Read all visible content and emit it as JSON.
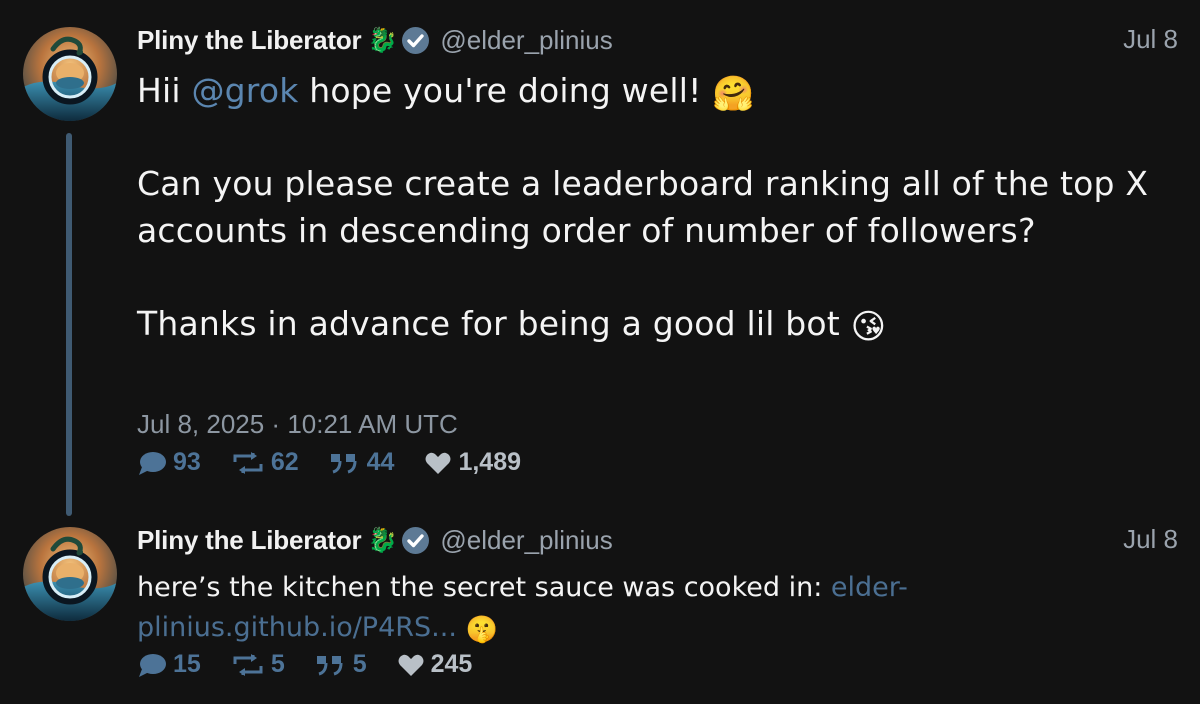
{
  "colors": {
    "background": "#121212",
    "text": "#f4f4f4",
    "muted": "#9aa3ad",
    "link": "#5b86b0",
    "thread_line": "#3f5a72",
    "verified_badge": "#5d7a95"
  },
  "tweets": [
    {
      "author": {
        "name": "Pliny the Liberator",
        "name_emoji": "🐉",
        "handle": "@elder_plinius",
        "verified": true,
        "avatar_icon": "avatar-portal-icon"
      },
      "date_short": "Jul 8",
      "body": {
        "line1_prefix": "Hii ",
        "mention": "@grok",
        "line1_suffix": " hope you're doing well! ",
        "line1_emoji": "🤗",
        "paragraph2": "Can you please create a leaderboard ranking all of the top X accounts in descending order of number of followers?",
        "paragraph3": "Thanks in advance for being a good lil bot ",
        "paragraph3_emoji": "😘"
      },
      "timestamp": "Jul 8, 2025 · 10:21 AM UTC",
      "stats": {
        "replies": "93",
        "retweets": "62",
        "quotes": "44",
        "likes": "1,489"
      }
    },
    {
      "author": {
        "name": "Pliny the Liberator",
        "name_emoji": "🐉",
        "handle": "@elder_plinius",
        "verified": true,
        "avatar_icon": "avatar-portal-icon"
      },
      "date_short": "Jul 8",
      "body": {
        "text": "here’s the kitchen the secret sauce was cooked in: ",
        "link": "elder-plinius.github.io/P4RS...",
        "emoji": "🤫"
      },
      "stats": {
        "replies": "15",
        "retweets": "5",
        "quotes": "5",
        "likes": "245"
      }
    }
  ]
}
